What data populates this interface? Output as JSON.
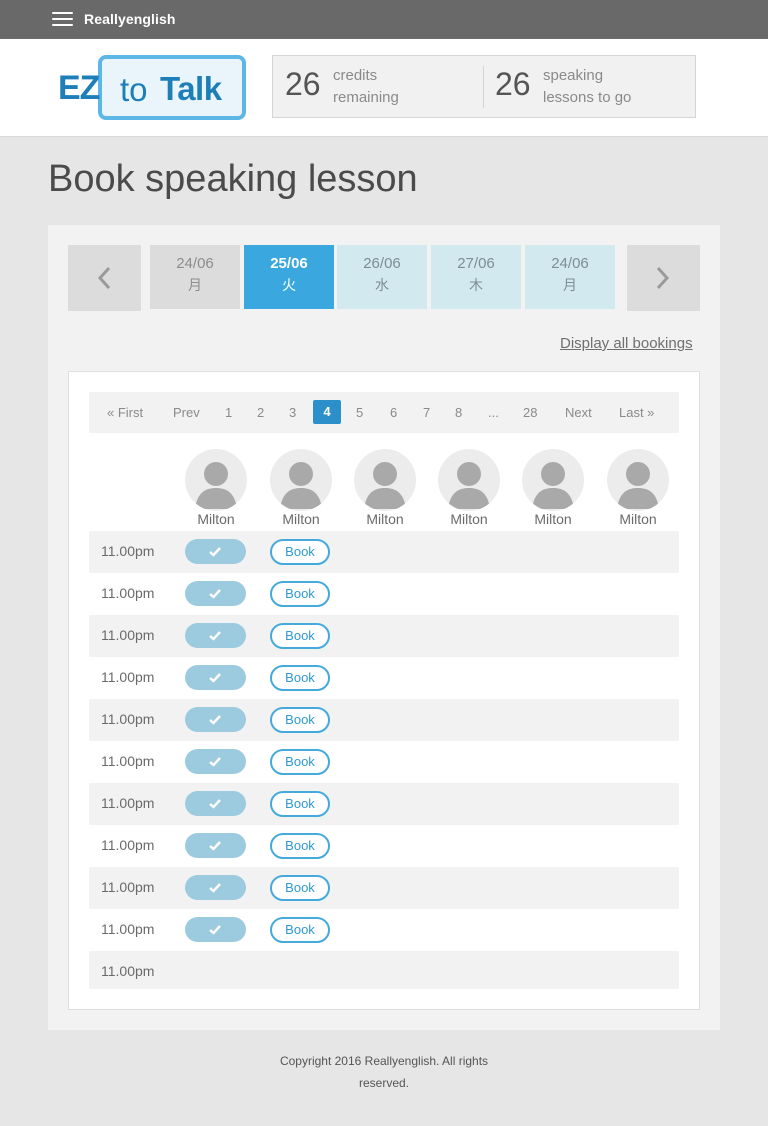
{
  "topbar": {
    "brand": "Reallyenglish"
  },
  "logo": {
    "ez": "EZ",
    "to": "to",
    "talk": "Talk"
  },
  "stats": {
    "credits_value": "26",
    "credits_label_1": "credits",
    "credits_label_2": "remaining",
    "lessons_value": "26",
    "lessons_label_1": "speaking",
    "lessons_label_2": "lessons to go"
  },
  "page_title": "Book speaking lesson",
  "dates": [
    {
      "date": "24/06",
      "weekday": "月"
    },
    {
      "date": "25/06",
      "weekday": "火"
    },
    {
      "date": "26/06",
      "weekday": "水"
    },
    {
      "date": "27/06",
      "weekday": "木"
    },
    {
      "date": "24/06",
      "weekday": "月"
    }
  ],
  "display_all": "Display all bookings",
  "pager": {
    "first": "« First",
    "prev": "Prev",
    "pages": [
      "1",
      "2",
      "3",
      "4",
      "5",
      "6",
      "7",
      "8",
      "...",
      "28"
    ],
    "current": "4",
    "next": "Next",
    "last": "Last »"
  },
  "tutors": [
    "Milton",
    "Milton",
    "Milton",
    "Milton",
    "Milton",
    "Milton"
  ],
  "book_label": "Book",
  "slots": [
    {
      "time": "11.00pm"
    },
    {
      "time": "11.00pm"
    },
    {
      "time": "11.00pm"
    },
    {
      "time": "11.00pm"
    },
    {
      "time": "11.00pm"
    },
    {
      "time": "11.00pm"
    },
    {
      "time": "11.00pm"
    },
    {
      "time": "11.00pm"
    },
    {
      "time": "11.00pm"
    },
    {
      "time": "11.00pm"
    },
    {
      "time": "11.00pm"
    }
  ],
  "footer": {
    "line1": "Copyright 2016 Reallyenglish. All rights",
    "line2": "reserved."
  },
  "colors": {
    "accent": "#3aa8df",
    "topbar": "#696969",
    "booked": "#9ccbe0"
  }
}
